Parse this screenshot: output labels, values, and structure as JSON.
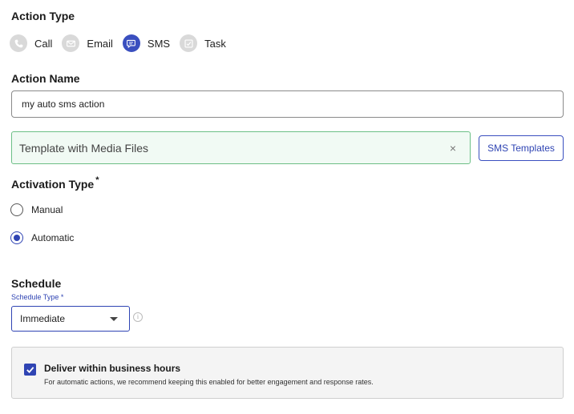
{
  "action_type": {
    "title": "Action Type",
    "options": [
      {
        "label": "Call",
        "icon": "phone-icon",
        "selected": false
      },
      {
        "label": "Email",
        "icon": "email-icon",
        "selected": false
      },
      {
        "label": "SMS",
        "icon": "chat-icon",
        "selected": true
      },
      {
        "label": "Task",
        "icon": "task-icon",
        "selected": false
      }
    ]
  },
  "action_name": {
    "title": "Action Name",
    "value": "my auto sms action"
  },
  "template": {
    "value": "Template with Media Files",
    "clear_glyph": "×",
    "button_label": "SMS Templates"
  },
  "activation": {
    "title": "Activation Type",
    "required_mark": "*",
    "options": [
      {
        "label": "Manual",
        "selected": false
      },
      {
        "label": "Automatic",
        "selected": true
      }
    ]
  },
  "schedule": {
    "title": "Schedule",
    "type_label": "Schedule Type *",
    "type_value": "Immediate",
    "info_glyph": "i"
  },
  "business_hours": {
    "checked": true,
    "title": "Deliver within business hours",
    "description": "For automatic actions, we recommend keeping this enabled for better engagement and response rates."
  },
  "colors": {
    "accent": "#2f44b3",
    "inactive_icon_bg": "#d9d9d9",
    "template_bg": "#f1faf4",
    "template_border": "#6cbf86"
  }
}
